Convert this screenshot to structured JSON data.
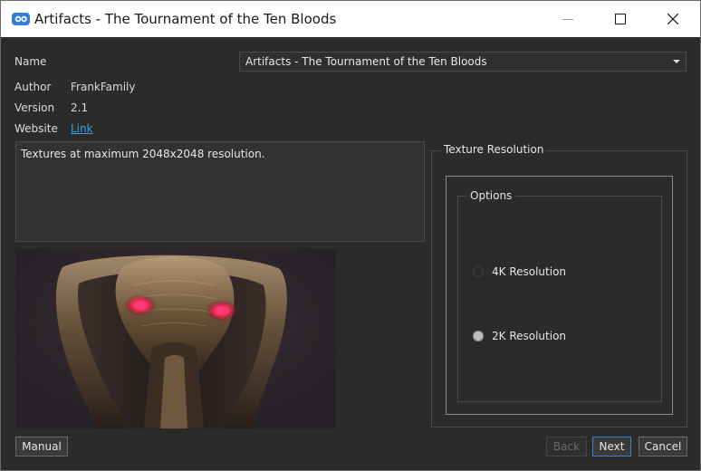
{
  "window": {
    "title": "Artifacts - The Tournament of the Ten Bloods",
    "icons": [
      "app-logo-icon",
      "minimize-icon",
      "maximize-icon",
      "close-icon"
    ]
  },
  "info": {
    "name_label": "Name",
    "name_value": "Artifacts - The Tournament of the Ten Bloods",
    "author_label": "Author",
    "author_value": "FrankFamily",
    "version_label": "Version",
    "version_value": "2.1",
    "website_label": "Website",
    "website_link": "Link"
  },
  "description": "Textures at maximum 2048x2048 resolution.",
  "texture_group": {
    "title": "Texture Resolution",
    "options_title": "Options",
    "options": [
      {
        "label": "4K Resolution",
        "checked": false
      },
      {
        "label": "2K Resolution",
        "checked": true
      }
    ]
  },
  "buttons": {
    "manual": "Manual",
    "back": "Back",
    "next": "Next",
    "cancel": "Cancel"
  },
  "colors": {
    "background": "#2b2b2b",
    "link": "#3ea0e4",
    "default_button_border": "#3d7fd1",
    "preview_eyes": "#ff2a5a"
  }
}
